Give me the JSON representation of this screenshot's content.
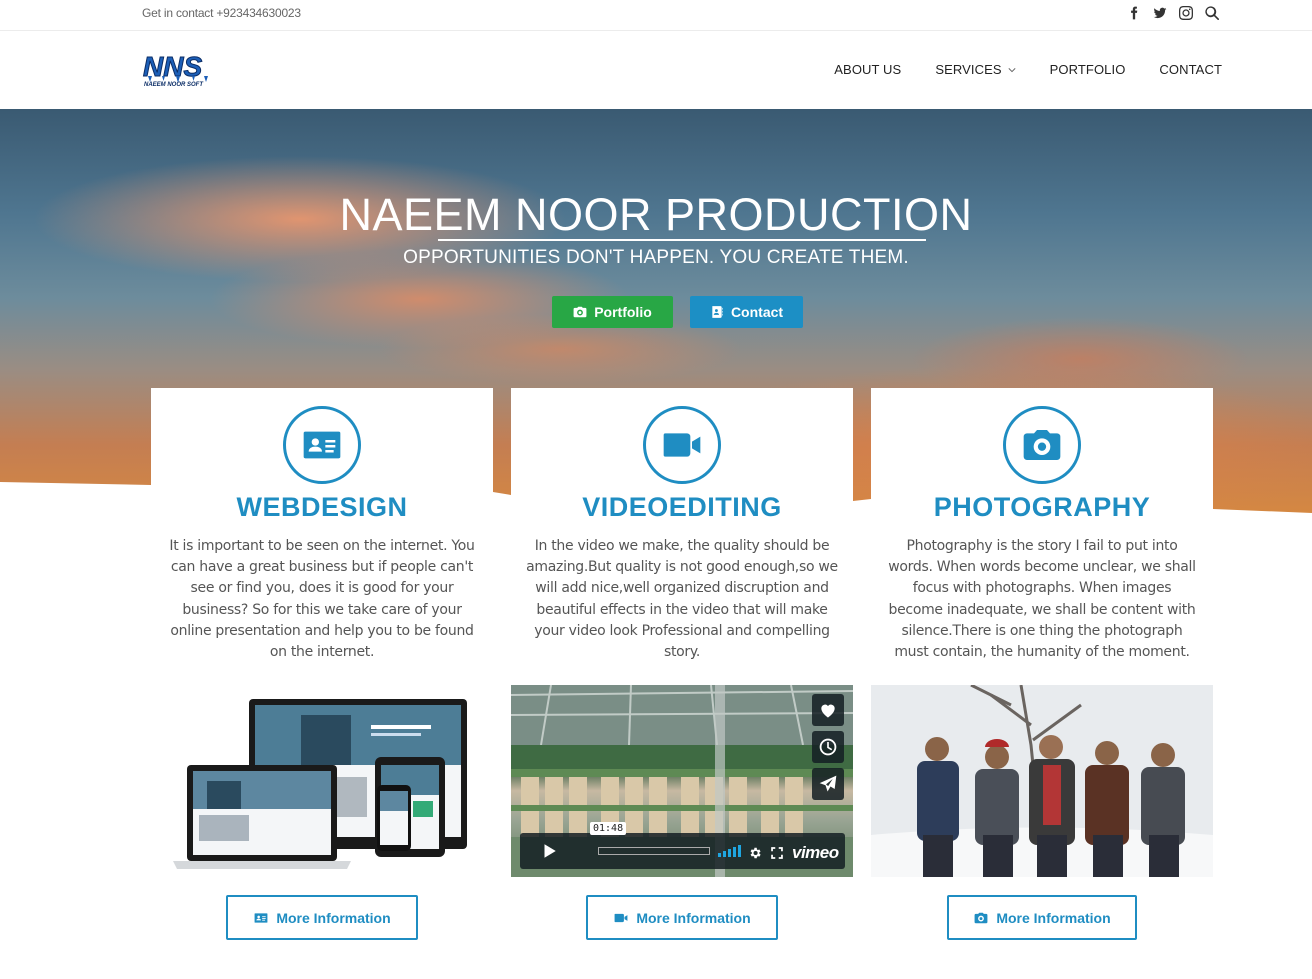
{
  "topbar": {
    "contact_text": "Get in contact +923434630023",
    "social": [
      "facebook-icon",
      "twitter-icon",
      "instagram-icon",
      "search-icon"
    ]
  },
  "header": {
    "logo_text": "NNS",
    "logo_subtext": "NAEEM NOOR SOFT",
    "nav": [
      {
        "label": "ABOUT US"
      },
      {
        "label": "SERVICES"
      },
      {
        "label": "PORTFOLIO"
      },
      {
        "label": "CONTACT"
      }
    ]
  },
  "hero": {
    "title": "NAEEM NOOR PRODUCTION",
    "subtitle": "OPPORTUNITIES DON'T HAPPEN. YOU CREATE THEM.",
    "portfolio_button": "Portfolio",
    "contact_button": "Contact"
  },
  "services": [
    {
      "title": "WEBDESIGN",
      "icon": "id-card-icon",
      "text": "It is important to be seen on the internet. You can have a great business but if people can't see or find you, does it is good for your business? So for this we take care of your online presentation and help you to be found on the internet.",
      "button": "More Information"
    },
    {
      "title": "VIDEOEDITING",
      "icon": "video-camera-icon",
      "text": "In the video we make, the quality should be amazing.But quality is not good enough,so we will add nice,well organized discruption and beautiful effects in the video that will make your video look Professional and compelling story.",
      "button": "More Information"
    },
    {
      "title": "PHOTOGRAPHY",
      "icon": "camera-icon",
      "text": "Photography is the story I fail to put into words. When words become unclear, we shall focus with photographs. When images become inadequate, we shall be content with silence.There is one thing the photograph must contain, the humanity of the moment.",
      "button": "More Information"
    }
  ],
  "video_player": {
    "time": "01:48",
    "brand": "vimeo"
  },
  "colors": {
    "accent": "#1f8dc2",
    "portfolio_green": "#28a745",
    "contact_blue": "#1c8fc5"
  }
}
